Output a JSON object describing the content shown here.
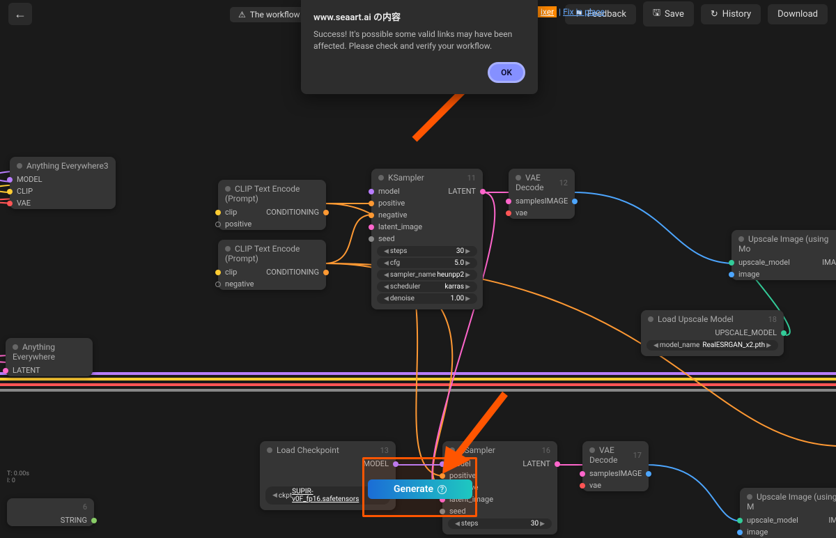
{
  "topbar": {
    "banner_warning": "The workflow yo",
    "fix_txt1": "ixer",
    "fix_sep": " | ",
    "fix_txt2": "Fix in place",
    "feedback": "Feedback",
    "save": "Save",
    "history": "History",
    "download": "Download"
  },
  "dialog": {
    "title": "www.seaart.ai の内容",
    "message": "Success! It's possible some valid links may have been affected. Please check and verify your workflow.",
    "ok": "OK"
  },
  "generate": "Generate",
  "stats": {
    "t": "T: 0.00s",
    "i": "I: 0"
  },
  "nodes": {
    "anything3": {
      "title": "Anything Everywhere3",
      "p1": "MODEL",
      "p2": "CLIP",
      "p3": "VAE"
    },
    "anything_lat": {
      "title": "Anything Everywhere",
      "p1": "LATENT"
    },
    "clip1": {
      "title": "CLIP Text Encode (Prompt)",
      "in": "clip",
      "out": "CONDITIONING",
      "w": "positive"
    },
    "clip2": {
      "title": "CLIP Text Encode (Prompt)",
      "in": "clip",
      "out": "CONDITIONING",
      "w": "negative"
    },
    "ksamp11": {
      "title": "KSampler",
      "idx": "11",
      "out": "LATENT",
      "in1": "model",
      "in2": "positive",
      "in3": "negative",
      "in4": "latent_image",
      "in5": "seed",
      "w_steps_l": "steps",
      "w_steps_v": "30",
      "w_cfg_l": "cfg",
      "w_cfg_v": "5.0",
      "w_samp_l": "sampler_name",
      "w_samp_v": "heunpp2",
      "w_sched_l": "scheduler",
      "w_sched_v": "karras",
      "w_den_l": "denoise",
      "w_den_v": "1.00"
    },
    "vae12": {
      "title": "VAE Decode",
      "idx": "12",
      "in1": "samples",
      "in2": "vae",
      "out": "IMAGE"
    },
    "upimg": {
      "title": "Upscale Image (using Mo",
      "in1": "upscale_model",
      "in2": "image",
      "out": "IMA"
    },
    "upmodel": {
      "title": "Load Upscale Model",
      "idx": "18",
      "out": "UPSCALE_MODEL",
      "w_l": "model_name",
      "w_v": "RealESRGAN_x2.pth"
    },
    "loadckpt": {
      "title": "Load Checkpoint",
      "idx": "13",
      "out1": "MODEL",
      "w_l": "ckpt",
      "w_v": "SUPIR-v0F_fp16.safetensors"
    },
    "ksamp16": {
      "title": "KSampler",
      "idx": "16",
      "out": "LATENT",
      "in1": "model",
      "in2": "positive",
      "in3": "negative",
      "in4": "latent_image",
      "in5": "seed",
      "w_steps_l": "steps",
      "w_steps_v": "30"
    },
    "vae17": {
      "title": "VAE Decode",
      "idx": "17",
      "in1": "samples",
      "in2": "vae",
      "out": "IMAGE"
    },
    "upimg2": {
      "title": "Upscale Image (using M",
      "in1": "upscale_model",
      "in2": "image",
      "out": "IM"
    },
    "node6": {
      "idx": "6",
      "out": "STRING"
    }
  }
}
